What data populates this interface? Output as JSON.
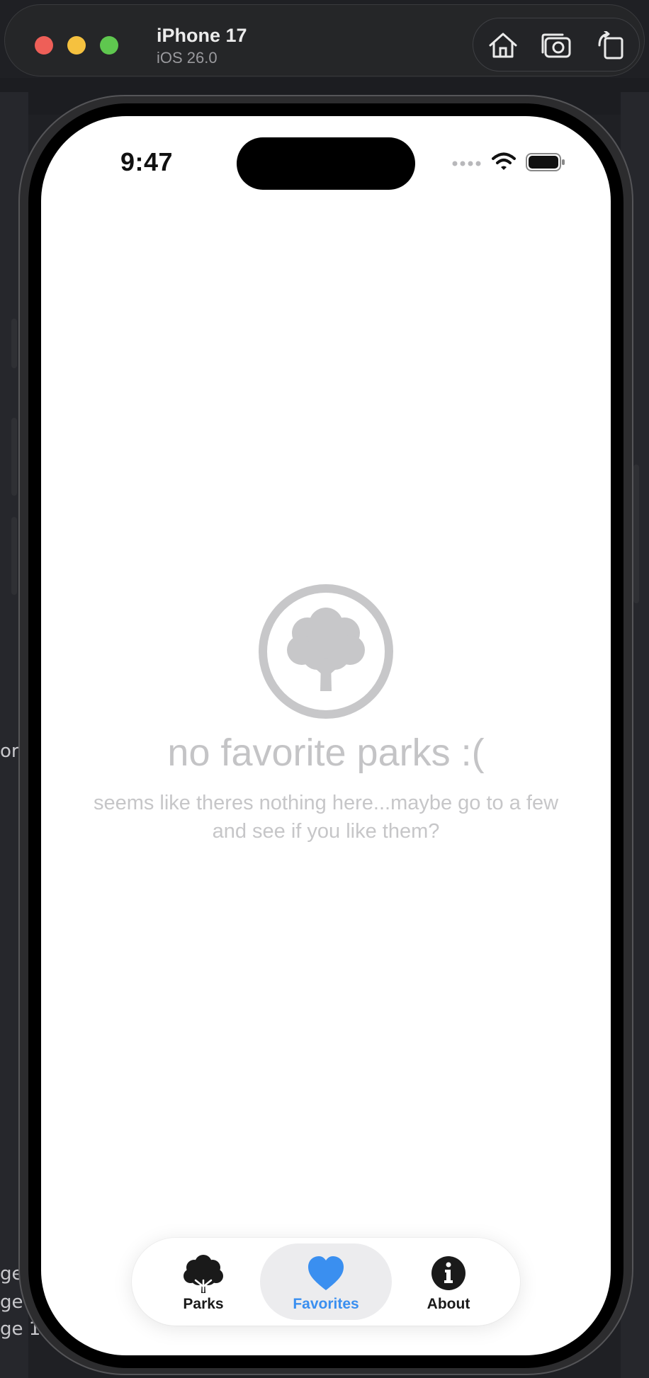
{
  "simulator": {
    "device_name": "iPhone 17",
    "os_version": "iOS 26.0",
    "controls": [
      "home-icon",
      "screenshot-camera-icon",
      "rotate-icon"
    ]
  },
  "background_text": {
    "left_fragments": [
      "or",
      "ge",
      "ge",
      "ge 1"
    ]
  },
  "status_bar": {
    "time": "9:47",
    "icons": [
      "cellular-dots-icon",
      "wifi-icon",
      "battery-icon"
    ]
  },
  "empty_state": {
    "icon": "tree-circle-icon",
    "title": "no favorite parks :(",
    "subtitle": "seems like theres nothing here...maybe go to a few and see if you like them?"
  },
  "tab_bar": {
    "selected": "Favorites",
    "tabs": [
      {
        "label": "Parks",
        "icon": "tree-icon"
      },
      {
        "label": "Favorites",
        "icon": "heart-icon"
      },
      {
        "label": "About",
        "icon": "info-icon"
      }
    ]
  },
  "colors": {
    "accent": "#3a8ff0",
    "empty_state_gray": "#c4c4c6",
    "traffic_red": "#ee5f58",
    "traffic_yellow": "#f5c13f",
    "traffic_green": "#5fc74f"
  }
}
